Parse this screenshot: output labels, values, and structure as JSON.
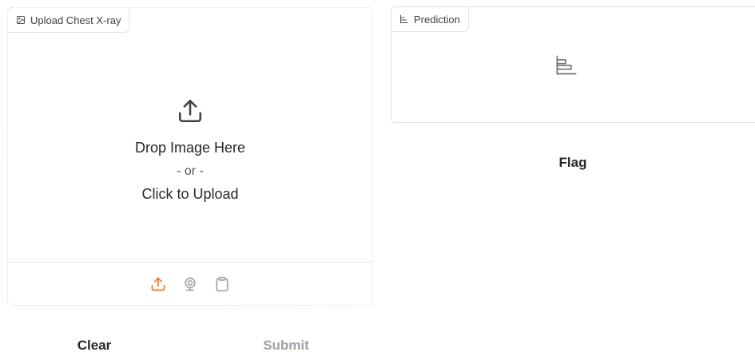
{
  "upload": {
    "label": "Upload Chest X-ray",
    "label_icon": "image-icon",
    "drop_text": "Drop Image Here",
    "or_text": "- or -",
    "click_text": "Click to Upload",
    "sources": [
      {
        "name": "upload-source-icon",
        "active": true
      },
      {
        "name": "webcam-source-icon",
        "active": false
      },
      {
        "name": "clipboard-source-icon",
        "active": false
      }
    ]
  },
  "prediction": {
    "label": "Prediction",
    "label_icon": "bar-chart-icon",
    "empty_icon": "bar-chart-icon"
  },
  "buttons": {
    "flag": "Flag",
    "clear": "Clear",
    "submit": "Submit"
  },
  "colors": {
    "accent": "#f97316",
    "muted_icon": "#a1a1aa",
    "border": "#e4e4e7",
    "disabled_text": "#a1a1aa"
  }
}
